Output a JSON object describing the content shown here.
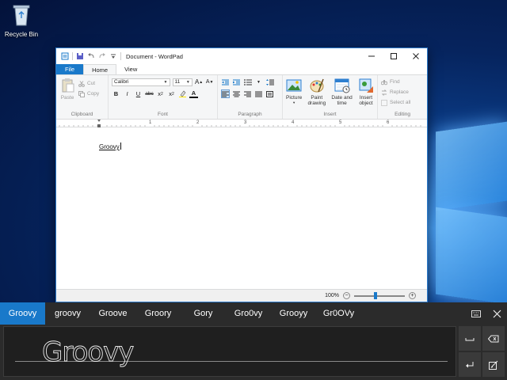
{
  "desktop": {
    "recycle_bin_label": "Recycle Bin"
  },
  "window": {
    "title": "Document - WordPad",
    "tabs": [
      {
        "label": "File"
      },
      {
        "label": "Home"
      },
      {
        "label": "View"
      }
    ]
  },
  "ribbon": {
    "clipboard": {
      "label": "Clipboard",
      "paste": "Paste",
      "cut": "Cut",
      "copy": "Copy"
    },
    "font": {
      "label": "Font",
      "family": "Calibri",
      "size": "11"
    },
    "paragraph": {
      "label": "Paragraph"
    },
    "insert": {
      "label": "Insert",
      "picture": "Picture",
      "paint_drawing_1": "Paint",
      "paint_drawing_2": "drawing",
      "date_time_1": "Date and",
      "date_time_2": "time",
      "insert_object_1": "Insert",
      "insert_object_2": "object"
    },
    "editing": {
      "label": "Editing",
      "find": "Find",
      "replace": "Replace",
      "select_all": "Select all"
    }
  },
  "ruler": {
    "numbers": [
      "1",
      "2",
      "3",
      "4",
      "5",
      "6"
    ]
  },
  "document": {
    "text": "Groovy"
  },
  "statusbar": {
    "zoom": "100%",
    "zoom_level": 0.42
  },
  "handwriting": {
    "candidates": [
      "Groovy",
      "groovy",
      "Groove",
      "Groory",
      "Gory",
      "Gro0vy",
      "Grooуy",
      "Gr0OVy"
    ],
    "selected_index": 0,
    "ink_text": "Groovy"
  },
  "colors": {
    "accent": "#1979ca",
    "panel_bg": "#2b2b2b"
  }
}
